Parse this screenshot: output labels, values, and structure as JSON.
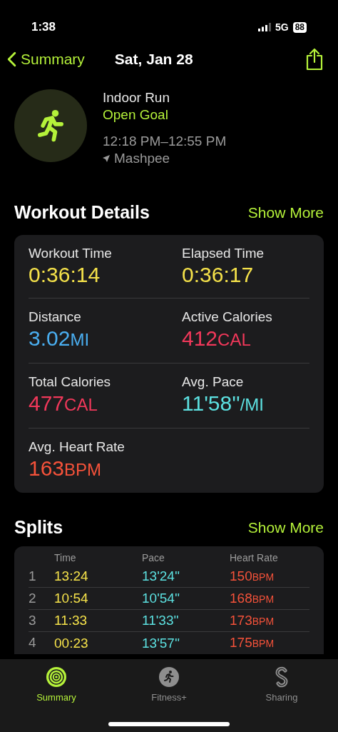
{
  "status_bar": {
    "time": "1:38",
    "network": "5G",
    "battery": "88"
  },
  "nav": {
    "back": "Summary",
    "title": "Sat, Jan 28"
  },
  "workout": {
    "name": "Indoor Run",
    "goal": "Open Goal",
    "time_range": "12:18 PM–12:55 PM",
    "location": "Mashpee"
  },
  "details": {
    "title": "Workout Details",
    "action": "Show More",
    "metrics": [
      {
        "label": "Workout Time",
        "value": "0:36:14",
        "color": "#f4e14a"
      },
      {
        "label": "Elapsed Time",
        "value": "0:36:17",
        "color": "#f4e14a"
      },
      {
        "label": "Distance",
        "value": "3.02",
        "unit": "MI",
        "color": "#4aaef0"
      },
      {
        "label": "Active Calories",
        "value": "412",
        "unit": "CAL",
        "color": "#f0385a"
      },
      {
        "label": "Total Calories",
        "value": "477",
        "unit": "CAL",
        "color": "#f0385a"
      },
      {
        "label": "Avg. Pace",
        "value": "11'58''",
        "unit": "/MI",
        "color": "#5ce0e0"
      },
      {
        "label": "Avg. Heart Rate",
        "value": "163",
        "unit": "BPM",
        "color": "#f5523a"
      }
    ]
  },
  "splits": {
    "title": "Splits",
    "action": "Show More",
    "columns": [
      {
        "label": "Time",
        "color": "#f4e14a"
      },
      {
        "label": "Pace",
        "color": "#5ce0e0"
      },
      {
        "label": "Heart Rate",
        "color": "#f5523a"
      }
    ],
    "rows": [
      {
        "index": "1",
        "cells": [
          {
            "value": "13:24"
          },
          {
            "value": "13'24''"
          },
          {
            "value": "150",
            "unit": "BPM"
          }
        ]
      },
      {
        "index": "2",
        "cells": [
          {
            "value": "10:54"
          },
          {
            "value": "10'54''"
          },
          {
            "value": "168",
            "unit": "BPM"
          }
        ]
      },
      {
        "index": "3",
        "cells": [
          {
            "value": "11:33"
          },
          {
            "value": "11'33''"
          },
          {
            "value": "173",
            "unit": "BPM"
          }
        ]
      },
      {
        "index": "4",
        "cells": [
          {
            "value": "00:23"
          },
          {
            "value": "13'57''"
          },
          {
            "value": "175",
            "unit": "BPM"
          }
        ]
      }
    ]
  },
  "tab_bar": [
    {
      "kind": "summary",
      "label": "Summary",
      "selected": true
    },
    {
      "kind": "fitness",
      "label": "Fitness+",
      "selected": false
    },
    {
      "kind": "sharing",
      "label": "Sharing",
      "selected": false
    }
  ]
}
